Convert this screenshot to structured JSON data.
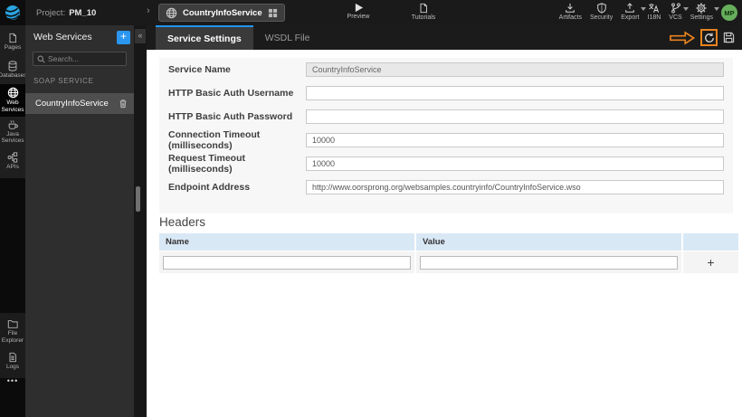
{
  "top_bar": {
    "project_label": "Project:",
    "project_name": "PM_10",
    "breadcrumb_chevron": "›",
    "service_tab": "CountryInfoService",
    "preview_label": "Preview",
    "tutorials_label": "Tutorials",
    "right_items": [
      {
        "label": "Artifacts"
      },
      {
        "label": "Security"
      },
      {
        "label": "Export"
      },
      {
        "label": "I18N"
      },
      {
        "label": "VCS"
      },
      {
        "label": "Settings"
      }
    ],
    "avatar_initials": "MP"
  },
  "rail": {
    "top_items": [
      {
        "label": "Pages",
        "active": false
      },
      {
        "label": "Databases",
        "active": false
      },
      {
        "label": "Web Services",
        "active": true
      },
      {
        "label": "Java Services",
        "active": false
      },
      {
        "label": "APIs",
        "active": false
      }
    ],
    "bottom_items": [
      {
        "label": "File Explorer"
      },
      {
        "label": "Logs"
      }
    ],
    "more_label": "•••"
  },
  "panel": {
    "title": "Web Services",
    "add_label": "+",
    "collapse_label": "«",
    "search_placeholder": "Search...",
    "section_label": "SOAP SERVICE",
    "selected_service": "CountryInfoService"
  },
  "tabs": [
    {
      "label": "Service Settings",
      "active": true
    },
    {
      "label": "WSDL File",
      "active": false
    }
  ],
  "form": {
    "fields": [
      {
        "label": "Service Name",
        "value": "CountryInfoService",
        "disabled": true
      },
      {
        "label": "HTTP Basic Auth Username",
        "value": ""
      },
      {
        "label": "HTTP Basic Auth Password",
        "value": ""
      },
      {
        "label": "Connection Timeout (milliseconds)",
        "value": "10000"
      },
      {
        "label": "Request Timeout (milliseconds)",
        "value": "10000"
      },
      {
        "label": "Endpoint Address",
        "value": "http://www.oorsprong.org/websamples.countryinfo/CountryInfoService.wso"
      }
    ]
  },
  "headers_section": {
    "title": "Headers",
    "columns": [
      "Name",
      "Value"
    ],
    "row": {
      "name": "",
      "value": ""
    },
    "add_label": "+"
  },
  "colors": {
    "accent_blue": "#2196f3",
    "annotation_orange": "#e8821e",
    "avatar_green": "#67ae5c",
    "table_header_bg": "#d9e8f5"
  }
}
